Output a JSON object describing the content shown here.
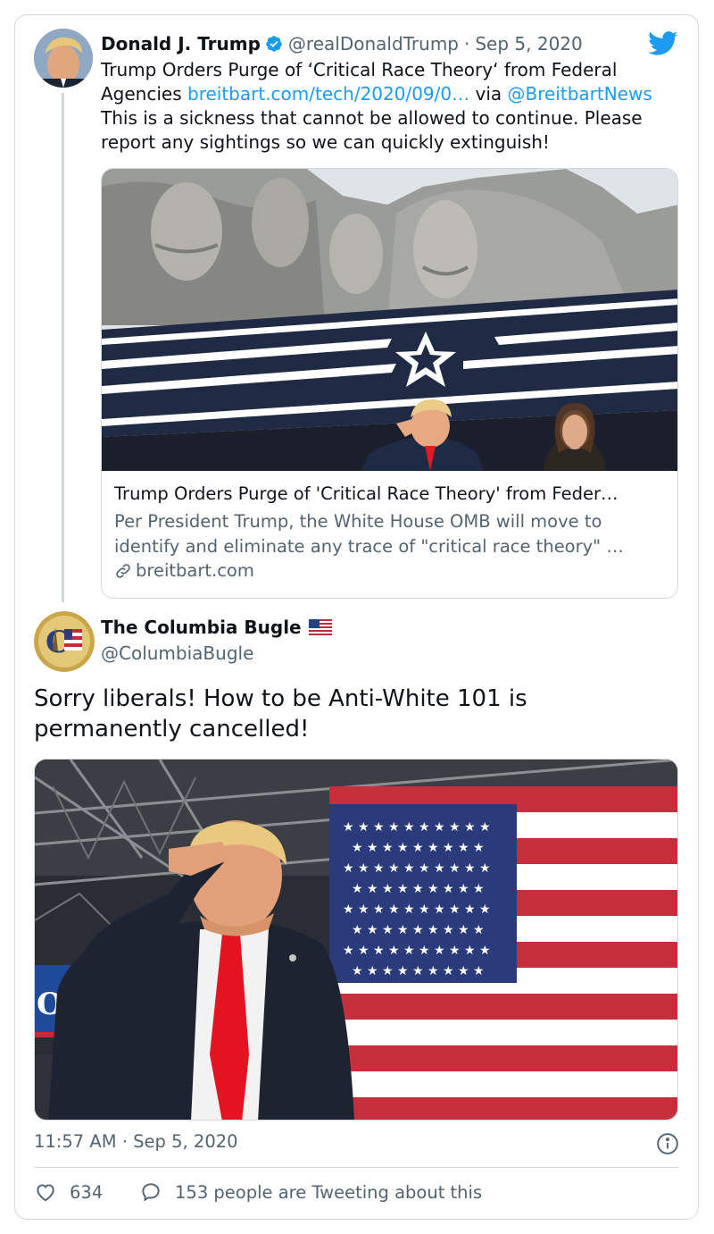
{
  "quoted_tweet": {
    "author_name": "Donald J. Trump",
    "author_handle": "@realDonaldTrump",
    "separator": "·",
    "date": "Sep 5, 2020",
    "text_part1": "Trump Orders Purge of ‘Critical Race Theory‘ from Federal Agencies ",
    "link_url": "breitbart.com/tech/2020/09/0…",
    "via_text": " via ",
    "via_mention": "@BreitbartNews",
    "text_part2": "This is a sickness that cannot be allowed to continue. Please report any sightings so we can quickly extinguish!",
    "link_card": {
      "title": "Trump Orders Purge of 'Critical Race Theory' from Feder…",
      "description": "Per President Trump, the White House OMB will move to identify and eliminate any trace of \"critical race theory\" …",
      "domain": "breitbart.com",
      "domain_icon": "link-icon"
    }
  },
  "main_tweet": {
    "author_name": "The Columbia Bugle",
    "author_flag": "us-flag-emoji",
    "author_handle": "@ColumbiaBugle",
    "text": "Sorry liberals! How to be Anti-White 101 is permanently cancelled!",
    "timestamp": "11:57 AM · Sep 5, 2020",
    "likes": "634",
    "conversation": "153 people are Tweeting about this"
  },
  "colors": {
    "link": "#1d9bf0",
    "secondary_text": "#536471",
    "border": "#cfd9de",
    "verified": "#1d9bf0",
    "twitter_brand": "#1d9bf0"
  },
  "icons": [
    "verified-badge-icon",
    "twitter-bird-icon",
    "link-icon",
    "info-icon",
    "heart-icon",
    "reply-bubble-icon"
  ]
}
